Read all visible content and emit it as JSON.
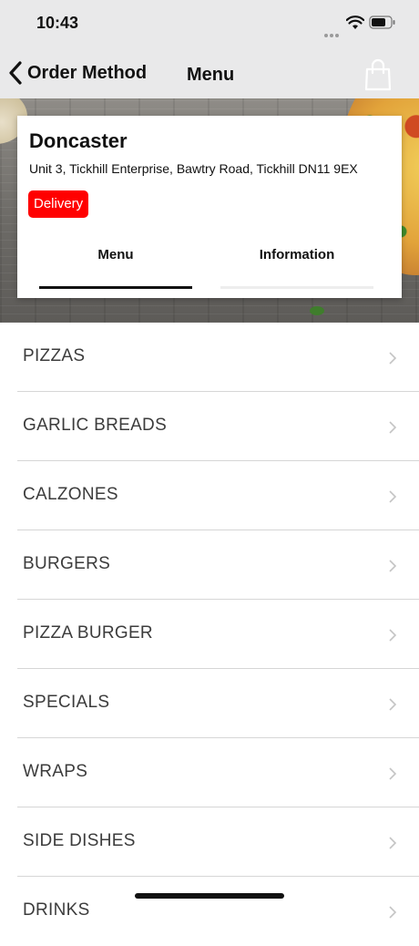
{
  "status_bar": {
    "time": "10:43"
  },
  "nav": {
    "back_label": "Order Method",
    "title": "Menu"
  },
  "store": {
    "name": "Doncaster",
    "address": "Unit 3, Tickhill Enterprise, Bawtry Road, Tickhill DN11 9EX",
    "badge": "Delivery"
  },
  "tabs": [
    {
      "label": "Menu",
      "active": true
    },
    {
      "label": "Information",
      "active": false
    }
  ],
  "menu_items": [
    {
      "label": "PIZZAS"
    },
    {
      "label": "GARLIC BREADS"
    },
    {
      "label": "CALZONES"
    },
    {
      "label": "BURGERS"
    },
    {
      "label": "PIZZA BURGER"
    },
    {
      "label": "SPECIALS"
    },
    {
      "label": "WRAPS"
    },
    {
      "label": "SIDE DISHES"
    },
    {
      "label": "DRINKS"
    }
  ],
  "colors": {
    "badge": "#ff0000",
    "nav_background": "#e9e9ea"
  }
}
